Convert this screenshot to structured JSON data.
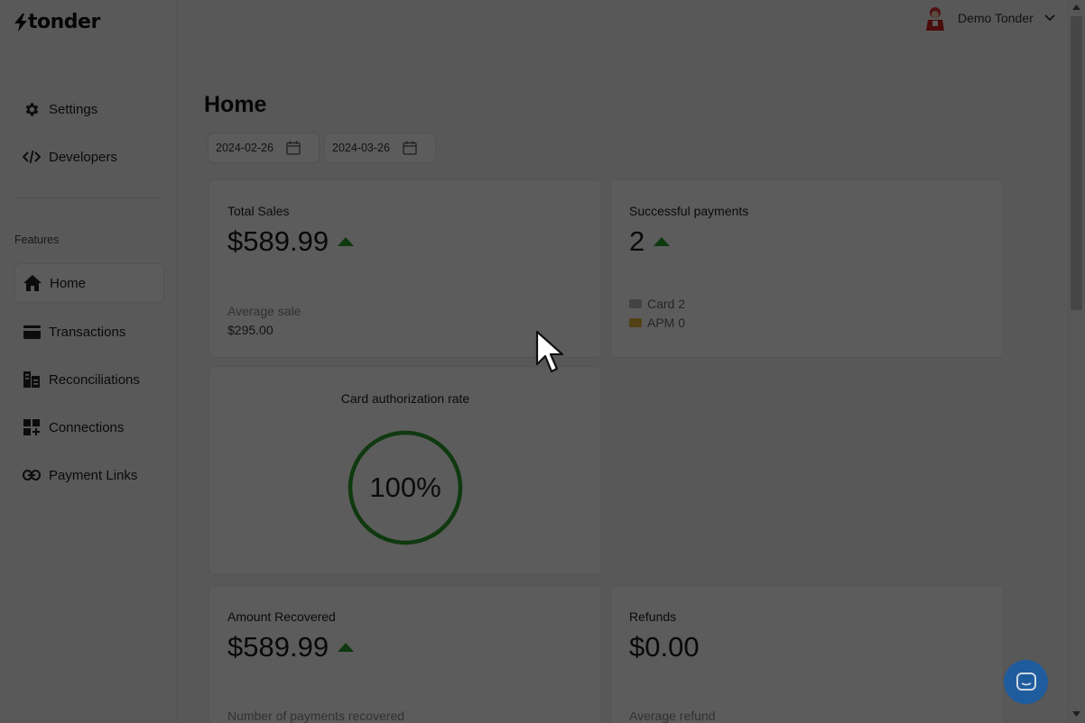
{
  "brand": {
    "logo_text": "tonder"
  },
  "user": {
    "name": "Demo Tonder"
  },
  "sidebar": {
    "top_items": [
      {
        "label": "Settings",
        "icon": "gear-icon"
      },
      {
        "label": "Developers",
        "icon": "code-icon"
      }
    ],
    "section_label": "Features",
    "features": [
      {
        "label": "Home",
        "icon": "home-icon",
        "active": true
      },
      {
        "label": "Transactions",
        "icon": "card-icon"
      },
      {
        "label": "Reconciliations",
        "icon": "reconcile-icon"
      },
      {
        "label": "Connections",
        "icon": "grid-plus-icon"
      },
      {
        "label": "Payment Links",
        "icon": "link-icon"
      }
    ]
  },
  "page": {
    "title": "Home",
    "date_from": "2024-02-26",
    "date_to": "2024-03-26"
  },
  "cards": {
    "total_sales": {
      "title": "Total Sales",
      "value": "$589.99",
      "trend": "up",
      "sub_label": "Average sale",
      "sub_value": "$295.00"
    },
    "successful_payments": {
      "title": "Successful payments",
      "value": "2",
      "trend": "up",
      "card_label": "Card 2",
      "apm_label": "APM 0"
    },
    "auth_rate": {
      "title": "Card authorization rate",
      "value": "100%",
      "rate": 1.0
    },
    "amount_recovered": {
      "title": "Amount Recovered",
      "value": "$589.99",
      "trend": "up",
      "sub_label": "Number of payments recovered"
    },
    "refunds": {
      "title": "Refunds",
      "value": "$0.00",
      "sub_label": "Average refund"
    }
  },
  "colors": {
    "accent_green": "#2a9d2a",
    "chat_blue": "#2e7fd9",
    "overlay": "rgba(0,0,0,0.64)"
  },
  "misc": {
    "chat_icon": "chat-icon",
    "cursor_icon": "mouse-pointer-icon"
  }
}
